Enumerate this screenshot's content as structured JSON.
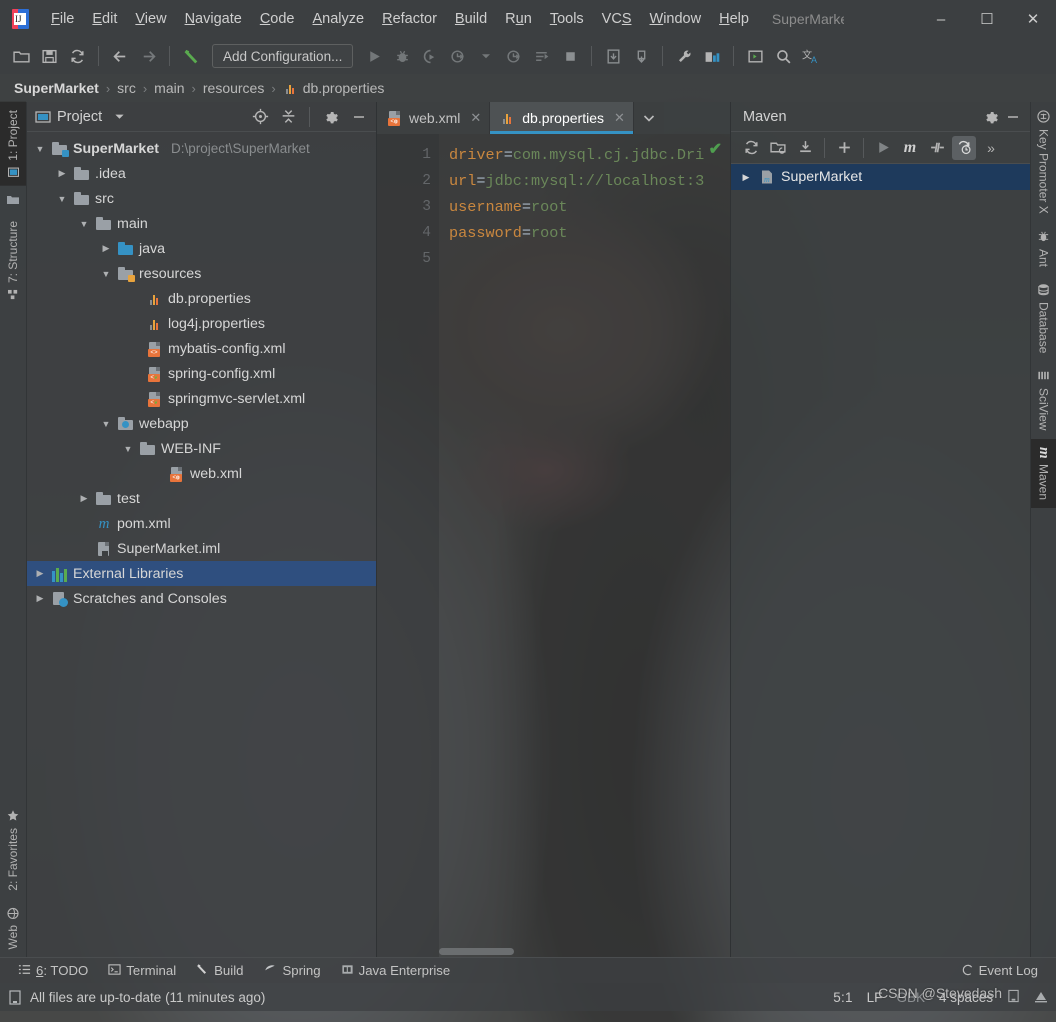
{
  "window": {
    "title": "SuperMarke",
    "logo_icon": "intellij-idea-logo",
    "minimize_label": "–",
    "maximize_label": "☐",
    "close_label": "✕"
  },
  "menu": [
    {
      "label": "File",
      "mnemonic": "F"
    },
    {
      "label": "Edit",
      "mnemonic": "E"
    },
    {
      "label": "View",
      "mnemonic": "V"
    },
    {
      "label": "Navigate",
      "mnemonic": "N"
    },
    {
      "label": "Code",
      "mnemonic": "C"
    },
    {
      "label": "Analyze",
      "mnemonic": "A"
    },
    {
      "label": "Refactor",
      "mnemonic": "R"
    },
    {
      "label": "Build",
      "mnemonic": "B"
    },
    {
      "label": "Run",
      "mnemonic": "u"
    },
    {
      "label": "Tools",
      "mnemonic": "T"
    },
    {
      "label": "VCS",
      "mnemonic": "S"
    },
    {
      "label": "Window",
      "mnemonic": "W"
    },
    {
      "label": "Help",
      "mnemonic": "H"
    }
  ],
  "toolbar": {
    "run_configuration": "Add Configuration...",
    "icons": [
      "open-project-icon",
      "save-all-icon",
      "sync-icon",
      "back-icon",
      "forward-icon",
      "build-icon",
      "run-icon",
      "debug-icon",
      "run-with-coverage-icon",
      "profile-icon",
      "profile-dropdown-icon",
      "attach-profiler-icon",
      "run-anything-icon",
      "stop-icon",
      "update-project-icon",
      "commit-icon",
      "settings-wrench-icon",
      "project-structure-icon",
      "run-terminal-icon",
      "search-everywhere-icon",
      "translate-icon"
    ]
  },
  "breadcrumb": {
    "items": [
      "SuperMarket",
      "src",
      "main",
      "resources",
      "db.properties"
    ],
    "separator": "›",
    "file_icon": "properties-file-icon"
  },
  "left_strip": {
    "top": [
      {
        "label": "1: Project",
        "icon": "project-icon",
        "active": true
      },
      {
        "label": "",
        "icon": "folder-icon",
        "active": false
      },
      {
        "label": "7: Structure",
        "icon": "structure-icon",
        "active": false
      }
    ],
    "bottom": [
      {
        "label": "2: Favorites",
        "icon": "star-icon",
        "active": false
      },
      {
        "label": "Web",
        "icon": "web-icon",
        "active": false
      }
    ]
  },
  "project_panel": {
    "title": "Project",
    "dropdown_icon": "chevron-down-icon",
    "header_icons": [
      "locate-icon",
      "collapse-all-icon",
      "settings-gear-icon",
      "hide-icon"
    ],
    "tree": [
      {
        "depth": 0,
        "label": "SuperMarket",
        "path": "D:\\project\\SuperMarket",
        "arrow": "down",
        "icon": "module-folder-icon",
        "bold": true,
        "selected": false
      },
      {
        "depth": 1,
        "label": ".idea",
        "path": "",
        "arrow": "right",
        "icon": "folder-icon",
        "bold": false,
        "selected": false
      },
      {
        "depth": 1,
        "label": "src",
        "path": "",
        "arrow": "down",
        "icon": "folder-icon",
        "bold": false,
        "selected": false
      },
      {
        "depth": 2,
        "label": "main",
        "path": "",
        "arrow": "down",
        "icon": "folder-icon",
        "bold": false,
        "selected": false
      },
      {
        "depth": 3,
        "label": "java",
        "path": "",
        "arrow": "right",
        "icon": "source-folder-icon",
        "bold": false,
        "selected": false
      },
      {
        "depth": 3,
        "label": "resources",
        "path": "",
        "arrow": "down",
        "icon": "resources-folder-icon",
        "bold": false,
        "selected": false
      },
      {
        "depth": 4,
        "label": "db.properties",
        "path": "",
        "arrow": "none",
        "icon": "properties-file-icon",
        "bold": false,
        "selected": false
      },
      {
        "depth": 4,
        "label": "log4j.properties",
        "path": "",
        "arrow": "none",
        "icon": "properties-file-icon",
        "bold": false,
        "selected": false
      },
      {
        "depth": 4,
        "label": "mybatis-config.xml",
        "path": "",
        "arrow": "none",
        "icon": "xml-file-icon",
        "bold": false,
        "selected": false
      },
      {
        "depth": 4,
        "label": "spring-config.xml",
        "path": "",
        "arrow": "none",
        "icon": "spring-xml-file-icon",
        "bold": false,
        "selected": false
      },
      {
        "depth": 4,
        "label": "springmvc-servlet.xml",
        "path": "",
        "arrow": "none",
        "icon": "spring-xml-file-icon",
        "bold": false,
        "selected": false
      },
      {
        "depth": 3,
        "label": "webapp",
        "path": "",
        "arrow": "down",
        "icon": "webapp-folder-icon",
        "bold": false,
        "selected": false
      },
      {
        "depth": 4,
        "label": "WEB-INF",
        "path": "",
        "arrow": "down",
        "icon": "folder-icon",
        "bold": false,
        "selected": false
      },
      {
        "depth": 5,
        "label": "web.xml",
        "path": "",
        "arrow": "none",
        "icon": "web-xml-file-icon",
        "bold": false,
        "selected": false
      },
      {
        "depth": 2,
        "label": "test",
        "path": "",
        "arrow": "right",
        "icon": "folder-icon",
        "bold": false,
        "selected": false
      },
      {
        "depth": 1,
        "label": "pom.xml",
        "path": "",
        "arrow": "none",
        "icon": "maven-pom-icon",
        "bold": false,
        "selected": false
      },
      {
        "depth": 1,
        "label": "SuperMarket.iml",
        "path": "",
        "arrow": "none",
        "icon": "iml-file-icon",
        "bold": false,
        "selected": false
      },
      {
        "depth": 0,
        "label": "External Libraries",
        "path": "",
        "arrow": "right",
        "icon": "libraries-icon",
        "bold": false,
        "selected": true
      },
      {
        "depth": 0,
        "label": "Scratches and Consoles",
        "path": "",
        "arrow": "right",
        "icon": "scratches-icon",
        "bold": false,
        "selected": false
      }
    ]
  },
  "editor": {
    "tabs": [
      {
        "label": "web.xml",
        "icon": "web-xml-file-icon",
        "active": false,
        "close_label": "✕"
      },
      {
        "label": "db.properties",
        "icon": "properties-file-icon",
        "active": true,
        "close_label": "✕"
      }
    ],
    "tab_overflow_icon": "chevron-down-icon",
    "line_numbers": [
      "1",
      "2",
      "3",
      "4",
      "5"
    ],
    "lines": [
      {
        "key": "driver",
        "eq": "=",
        "value": "com.mysql.cj.jdbc.Dri"
      },
      {
        "key": "url",
        "eq": "=",
        "value": "jdbc:mysql://localhost:3"
      },
      {
        "key": "username",
        "eq": "=",
        "value": "root"
      },
      {
        "key": "password",
        "eq": "=",
        "value": "root"
      },
      {
        "key": "",
        "eq": "",
        "value": ""
      }
    ],
    "inspection_icon": "inspection-ok-checkmark",
    "colors": {
      "key": "#c9873f",
      "value": "#6a8759",
      "equals": "#a9b7c6"
    }
  },
  "maven_panel": {
    "title": "Maven",
    "header_icons": [
      "settings-gear-icon",
      "hide-icon"
    ],
    "toolbar_icons": [
      "reimport-icon",
      "generate-sources-icon",
      "download-sources-icon",
      "add-maven-project-icon",
      "run-icon",
      "execute-maven-goal-icon",
      "toggle-skip-tests-icon",
      "toggle-offline-icon",
      "more-icon"
    ],
    "nodes": [
      {
        "label": "SuperMarket",
        "icon": "maven-project-icon",
        "arrow": "right",
        "selected": true
      }
    ]
  },
  "right_strip": [
    {
      "label": "Key Promoter X",
      "icon": "key-promoter-icon",
      "active": false
    },
    {
      "label": "Ant",
      "icon": "ant-icon",
      "active": false
    },
    {
      "label": "Database",
      "icon": "database-icon",
      "active": false
    },
    {
      "label": "SciView",
      "icon": "sciview-icon",
      "active": false
    },
    {
      "label": "Maven",
      "icon": "maven-icon",
      "active": true
    }
  ],
  "bottom_bar": [
    {
      "label": "6: TODO",
      "mnemonic": "6",
      "icon": "todo-icon"
    },
    {
      "label": "Terminal",
      "mnemonic": "",
      "icon": "terminal-icon"
    },
    {
      "label": "Build",
      "mnemonic": "",
      "icon": "build-hammer-icon"
    },
    {
      "label": "Spring",
      "mnemonic": "",
      "icon": "spring-leaf-icon"
    },
    {
      "label": "Java Enterprise",
      "mnemonic": "",
      "icon": "java-enterprise-icon"
    },
    {
      "label": "Event Log",
      "mnemonic": "",
      "icon": "event-log-icon"
    }
  ],
  "status_bar": {
    "message": "All files are up-to-date (11 minutes ago)",
    "message_icon": "file-status-icon",
    "caret_position": "5:1",
    "line_separator": "LF",
    "encoding": "GBK",
    "indent": "4 spaces",
    "lock_icon": "read-only-lock-icon",
    "inspection_icon": "inspection-level-icon",
    "watermark": "CSDN @Stevedash"
  }
}
